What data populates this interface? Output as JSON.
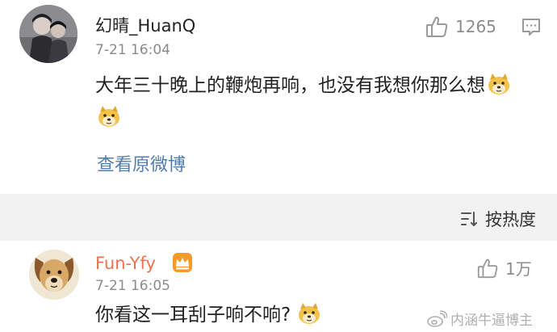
{
  "comments": [
    {
      "username": "幻晴_HuanQ",
      "timestamp": "7-21 16:04",
      "text": "大年三十晚上的鞭炮再响，也没有我想你那么想",
      "emoji": "doge",
      "emoji_count": 2,
      "likes": "1265",
      "view_original_label": "查看原微博"
    },
    {
      "username": "Fun-Yfy",
      "badge_icon": "crown-icon",
      "timestamp": "7-21 16:05",
      "text": "你看这一耳刮子响不响?",
      "emoji": "doge",
      "emoji_count": 1,
      "likes": "1万"
    }
  ],
  "sort": {
    "label": "按热度",
    "icon": "sort-icon"
  },
  "watermark": {
    "text": "内涵牛逼博主",
    "icon": "weibo-logo-icon"
  },
  "colors": {
    "link": "#507daf",
    "vip_username": "#eb7350",
    "muted": "#8c8c8c",
    "band": "#f2f2f2"
  }
}
